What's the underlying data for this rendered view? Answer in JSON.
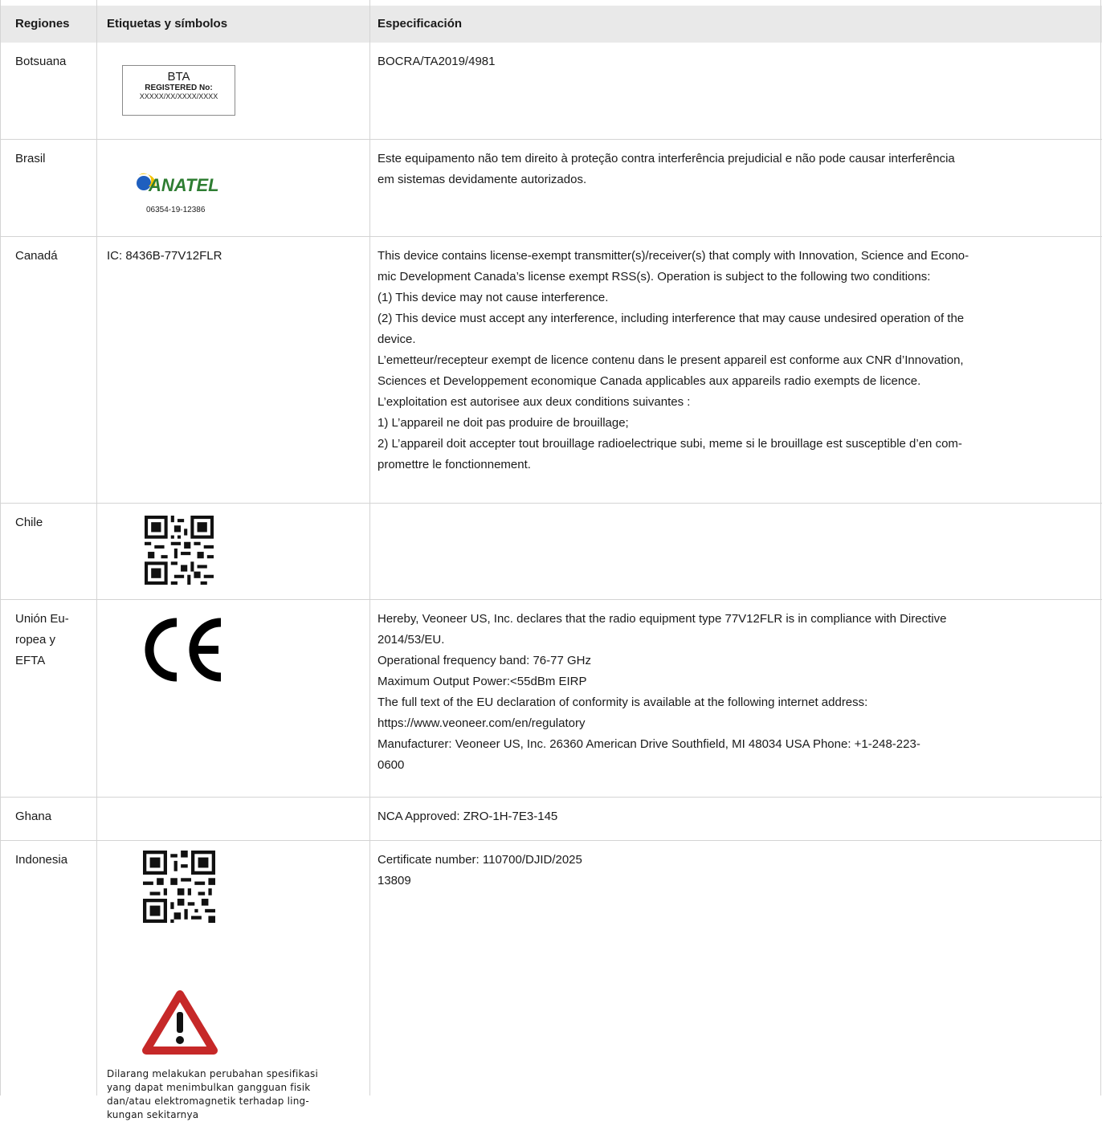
{
  "header": {
    "col1": "Regiones",
    "col2": "Etiquetas y símbolos",
    "col3": "Especificación"
  },
  "rows": {
    "botswana": {
      "region": "Botsuana",
      "label_box": {
        "line1": "BTA",
        "line2": "REGISTERED No:",
        "line3": "XXXXX/XX/XXXX/XXXX"
      },
      "spec": "BOCRA/TA2019/4981"
    },
    "brazil": {
      "region": "Brasil",
      "logo_text": "ANATEL",
      "logo_code": "06354-19-12386",
      "spec": [
        "Este equipamento não tem direito à proteção contra interferência prejudicial e não pode causar interferência",
        "em sistemas devidamente autorizados."
      ]
    },
    "canada": {
      "region": "Canadá",
      "label": "IC: 8436B-77V12FLR",
      "spec": [
        "This device contains license-exempt transmitter(s)/receiver(s) that comply with Innovation, Science and Econo-",
        "mic Development Canada’s license exempt RSS(s). Operation is subject to the following two conditions:",
        "(1) This device may not cause interference.",
        "(2) This device must accept any interference, including interference that may cause undesired operation of the",
        "device.",
        "L’emetteur/recepteur exempt de licence contenu dans le present appareil est conforme aux CNR d’Innovation,",
        "Sciences et Developpement economique Canada applicables aux appareils radio exempts de licence.",
        "L’exploitation est autorisee aux deux conditions suivantes :",
        "1) L’appareil ne doit pas produire de brouillage;",
        "2) L’appareil doit accepter tout brouillage radioelectrique subi, meme si le brouillage est susceptible d’en com-",
        "promettre le fonctionnement."
      ]
    },
    "chile": {
      "region": "Chile"
    },
    "eu": {
      "region": [
        "Unión Eu-",
        "ropea y",
        "EFTA"
      ],
      "mark": "CE",
      "spec": [
        "Hereby, Veoneer US, Inc. declares that the radio equipment type 77V12FLR is in compliance with Directive",
        "2014/53/EU.",
        "Operational frequency band: 76-77 GHz",
        "Maximum Output Power:<55dBm EIRP",
        "The full text of the EU declaration of conformity is available at the following internet address:",
        "https://www.veoneer.com/en/regulatory",
        "Manufacturer: Veoneer US, Inc. 26360 American Drive Southfield, MI 48034 USA Phone: +1-248-223-",
        "0600"
      ]
    },
    "ghana": {
      "region": "Ghana",
      "spec": "NCA Approved: ZRO-1H-7E3-145"
    },
    "indonesia": {
      "region": "Indonesia",
      "warning_text": [
        "Dilarang melakukan perubahan spesifikasi",
        "yang dapat menimbulkan gangguan fisik",
        "dan/atau elektromagnetik terhadap ling-",
        "kungan sekitarnya"
      ],
      "spec": [
        "Certificate number: 110700/DJID/2025",
        "13809"
      ]
    }
  },
  "colors": {
    "header_bg": "#e9e9e9",
    "grid": "#d4d4d4",
    "anatel_green": "#2e7d32",
    "anatel_yellow": "#f2c200",
    "anatel_blue": "#1f5fbf",
    "warning_red": "#c62828"
  }
}
